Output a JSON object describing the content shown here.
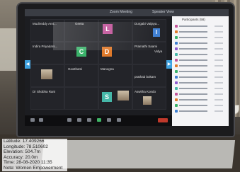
{
  "geotag": {
    "latitude": "Latitude: 17.409266",
    "longitude": "Longitude: 78.510602",
    "elevation": "Elevation: 504.7m",
    "accuracy": "Accuracy: 20.0m",
    "time": "Time: 28-08-2020 11:35",
    "note": "Note: Women Empowerment"
  },
  "screen": {
    "window_title": "Zoom Meeting",
    "view_label": "Speaker View",
    "panel_title": "Participants (58)",
    "tiles": [
      {
        "label": "Mudireddy Ann..."
      },
      {
        "label": "Geeta"
      },
      {
        "label": "L"
      },
      {
        "label": "Durgabi Vaijaya..."
      },
      {
        "label": "I"
      },
      {
        "label": "Indira Priyadars..."
      },
      {
        "label": "C"
      },
      {
        "label": "D"
      },
      {
        "label": "Pramathi Saami"
      },
      {
        "label": "Vidya"
      },
      {
        "label": "Gowthami"
      },
      {
        "label": "Manogna"
      },
      {
        "label": "prathab bokam"
      },
      {
        "label": "Dr Shobha Rani"
      },
      {
        "label": "S"
      },
      {
        "label": "Aswitha Kondo"
      }
    ]
  },
  "colors": {
    "avatar_l": "#c2559a",
    "avatar_i": "#3f7fd1",
    "avatar_c": "#3ab36a",
    "avatar_d": "#e07a2b",
    "avatar_s": "#46b7a8",
    "accent": "#3ea2e0"
  }
}
